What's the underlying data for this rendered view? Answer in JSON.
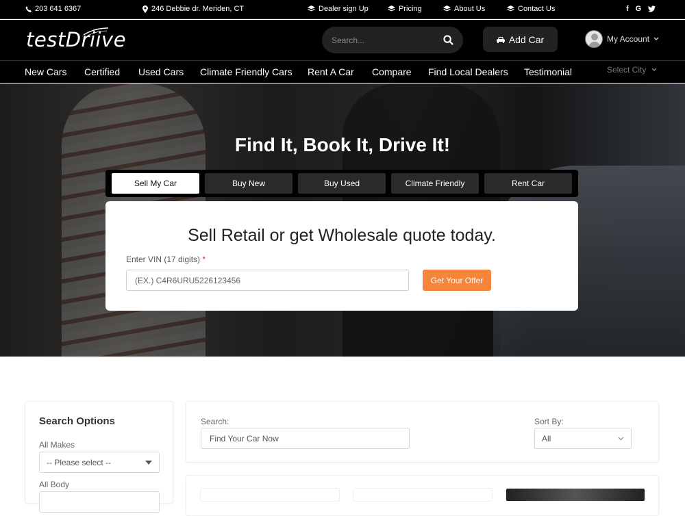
{
  "topbar": {
    "phone": "203 641 6367",
    "address": "246 Debbie dr. Meriden, CT",
    "links": [
      "Dealer sign Up",
      "Pricing",
      "About Us",
      "Contact Us"
    ],
    "social_icons": [
      "facebook-icon",
      "google-icon",
      "twitter-icon"
    ]
  },
  "header": {
    "logo": "testDriive",
    "search_placeholder": "Search...",
    "add_car": "Add Car",
    "account": "My Account"
  },
  "nav": {
    "items": [
      "New Cars",
      "Certified",
      "Used Cars",
      "Climate Friendly Cars",
      "Rent A Car",
      "Compare",
      "Find Local Dealers",
      "Testimonial"
    ],
    "city_select": "Select City"
  },
  "hero": {
    "title": "Find It, Book It, Drive It!",
    "tabs": [
      "Sell My Car",
      "Buy New",
      "Buy Used",
      "Climate Friendly",
      "Rent Car"
    ],
    "active_tab": "Sell My Car",
    "card_title": "Sell Retail or get Wholesale quote today.",
    "vin_label": "Enter VIN (17 digits)",
    "vin_required": "*",
    "vin_placeholder": "(EX.) C4R6URU5226123456",
    "offer_button": "Get Your Offer"
  },
  "filters": {
    "title": "Search Options",
    "makes_label": "All Makes",
    "makes_value": "-- Please select --",
    "body_label": "All Body"
  },
  "results": {
    "search_label": "Search:",
    "search_placeholder": "Find Your Car Now",
    "sort_label": "Sort By:",
    "sort_value": "All"
  },
  "colors": {
    "accent": "#f5853a",
    "header_bg": "#000000",
    "required": "#dd3333"
  }
}
